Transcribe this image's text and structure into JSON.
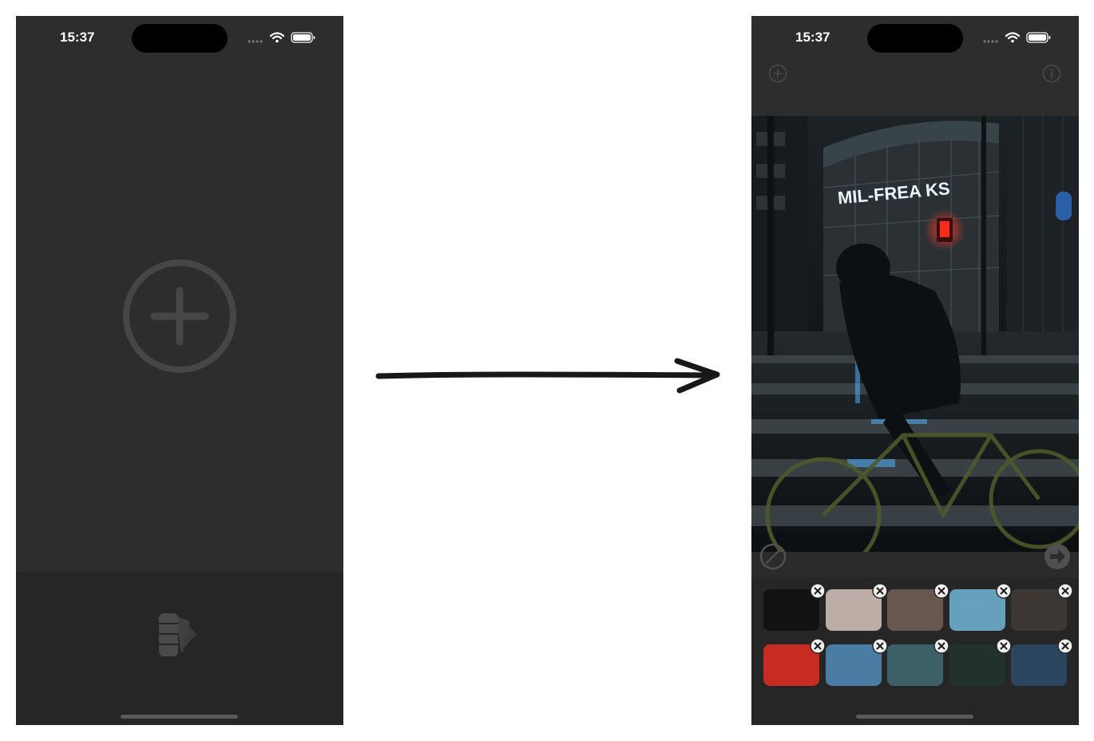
{
  "before": {
    "status": {
      "time": "15:37"
    },
    "main": {
      "icon": "add-circle-icon"
    },
    "tab_bar": {
      "icon": "color-palette-icon"
    }
  },
  "transition": {
    "icon": "hand-drawn-arrow-icon"
  },
  "after": {
    "status": {
      "time": "15:37"
    },
    "toolbar": {
      "left_icon": "add-circle-icon",
      "right_icon": "info-icon"
    },
    "photo": {
      "sign_text": "MIL-FREA KS",
      "description_icon": "photo-night-street-cyclist"
    },
    "controls": {
      "left_icon": "clear-slash-icon",
      "right_icon": "arrow-right-icon"
    },
    "palette": {
      "swatches": [
        {
          "color": "#121212"
        },
        {
          "color": "#bcaea6"
        },
        {
          "color": "#67574f"
        },
        {
          "color": "#65a0bc"
        },
        {
          "color": "#3d3733"
        },
        {
          "color": "#c72c22"
        },
        {
          "color": "#4a7ca4"
        },
        {
          "color": "#3d6068"
        },
        {
          "color": "#22312e"
        },
        {
          "color": "#2d4660"
        }
      ],
      "remove_icon": "close-circle-icon"
    }
  },
  "colors": {
    "phone_bg": "#2d2d2d",
    "bar_bg": "#262626",
    "icon_dim": "#484848"
  }
}
